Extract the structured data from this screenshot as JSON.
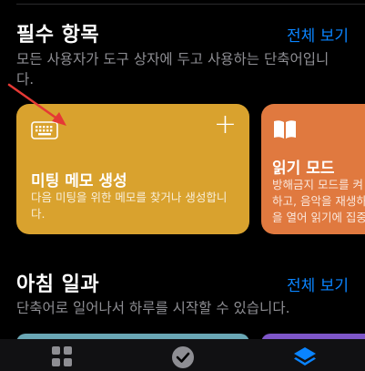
{
  "section1": {
    "title": "필수 항목",
    "see_all": "전체 보기",
    "subtitle_line1": "모든 사용자가 도구 상자에 두고 사용하는 단축어입니",
    "subtitle_line2": "다."
  },
  "cards": [
    {
      "icon": "keyboard-icon",
      "action": "+",
      "title": "미팅 메모 생성",
      "desc_line1": "다음 미팅을 위한 메모를 찾거나 생성합니",
      "desc_line2": "다.",
      "color": "#d9a22e"
    },
    {
      "icon": "book-icon",
      "title": "읽기 모드",
      "desc_line1": "방해금지 모드를 켜",
      "desc_line2": "하고, 음악을 재생하",
      "desc_line3": "을 열어 읽기에 집중",
      "color": "#e0793f"
    }
  ],
  "section2": {
    "title": "아침 일과",
    "see_all": "전체 보기",
    "subtitle": "단축어로 일어나서 하루를 시작할 수 있습니다."
  },
  "tabbar": {
    "tabs": [
      {
        "icon": "grid-icon"
      },
      {
        "icon": "check-circle-icon"
      },
      {
        "icon": "layers-icon",
        "active": true
      }
    ],
    "active_color": "#0a84ff"
  },
  "annotation": {
    "color": "#e53935"
  }
}
